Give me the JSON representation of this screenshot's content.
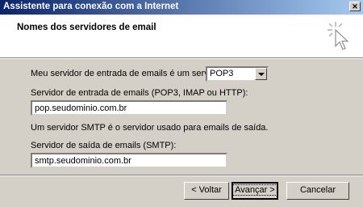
{
  "window": {
    "title": "Assistente para conexão com a Internet"
  },
  "header": {
    "title": "Nomes dos servidores de email",
    "icon": "wizard-cursor-icon"
  },
  "form": {
    "incoming_type_label": "Meu servidor de entrada de emails é um  servidor",
    "incoming_type_value": "POP3",
    "incoming_server_label": "Servidor de entrada de emails (POP3, IMAP ou HTTP):",
    "incoming_server_value": "pop.seudominio.com.br",
    "smtp_info": "Um servidor SMTP é o servidor usado para emails de saída.",
    "outgoing_server_label": "Servidor de saída de emails (SMTP):",
    "outgoing_server_value": "smtp.seudominio.com.br"
  },
  "buttons": {
    "back": "< Voltar",
    "next": "Avançar >",
    "cancel": "Cancelar"
  }
}
